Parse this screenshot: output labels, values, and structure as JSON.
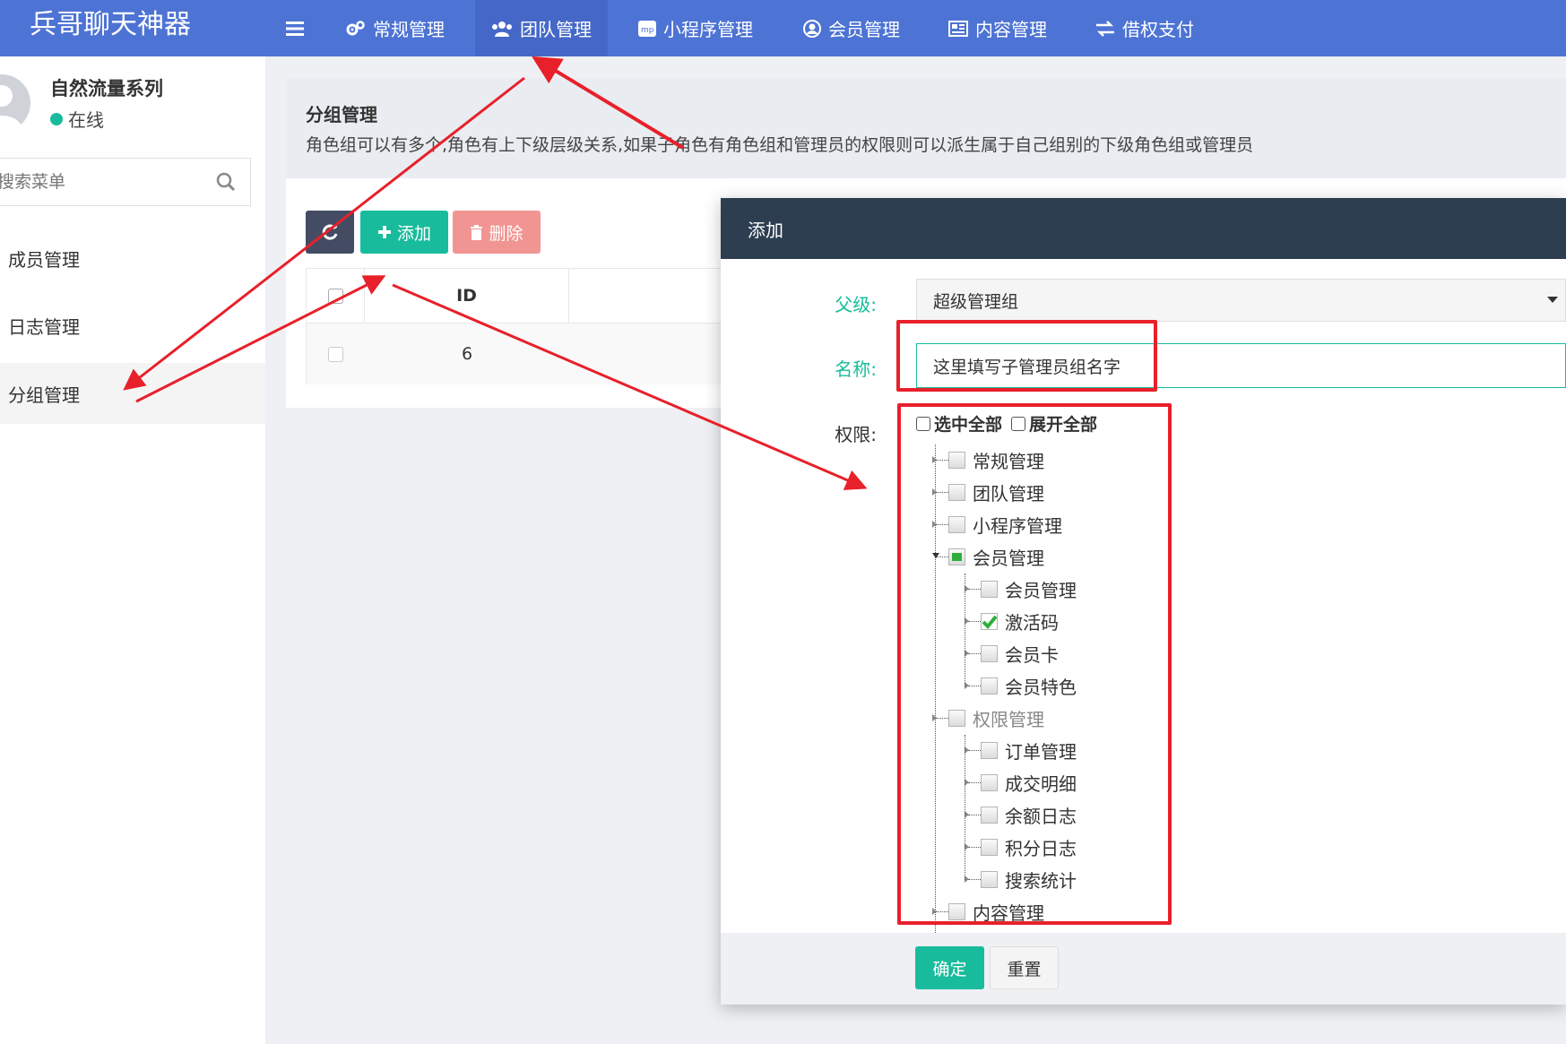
{
  "app": {
    "title": "兵哥聊天神器"
  },
  "topnav": {
    "items": [
      {
        "label": "常规管理",
        "icon": "gears-icon"
      },
      {
        "label": "团队管理",
        "icon": "users-icon"
      },
      {
        "label": "小程序管理",
        "icon": "mp-icon"
      },
      {
        "label": "会员管理",
        "icon": "user-circle-icon"
      },
      {
        "label": "内容管理",
        "icon": "newspaper-icon"
      },
      {
        "label": "借权支付",
        "icon": "exchange-icon"
      }
    ],
    "active": "团队管理"
  },
  "sidebar": {
    "user": {
      "name": "自然流量系列",
      "status": "在线",
      "status_color": "#18bc9c"
    },
    "search": {
      "placeholder": "搜索菜单"
    },
    "items": [
      {
        "label": "成员管理"
      },
      {
        "label": "日志管理"
      },
      {
        "label": "分组管理"
      }
    ],
    "active": "分组管理"
  },
  "page": {
    "title": "分组管理",
    "description": "角色组可以有多个,角色有上下级层级关系,如果子角色有角色组和管理员的权限则可以派生属于自己组别的下级角色组或管理员"
  },
  "toolbar": {
    "add_label": "添加",
    "delete_label": "删除"
  },
  "table": {
    "columns": [
      "ID"
    ],
    "rows": [
      {
        "id": "6"
      }
    ]
  },
  "modal": {
    "title": "添加",
    "parent": {
      "label": "父级:",
      "value": "超级管理组"
    },
    "name": {
      "label": "名称:",
      "value": "这里填写子管理员组名字"
    },
    "permissions": {
      "label": "权限:",
      "select_all": "选中全部",
      "expand_all": "展开全部",
      "tree": [
        {
          "label": "常规管理",
          "level": 0,
          "state": "unchecked"
        },
        {
          "label": "团队管理",
          "level": 0,
          "state": "unchecked"
        },
        {
          "label": "小程序管理",
          "level": 0,
          "state": "unchecked"
        },
        {
          "label": "会员管理",
          "level": 0,
          "state": "partial"
        },
        {
          "label": "会员管理",
          "level": 1,
          "state": "unchecked"
        },
        {
          "label": "激活码",
          "level": 1,
          "state": "checked"
        },
        {
          "label": "会员卡",
          "level": 1,
          "state": "unchecked"
        },
        {
          "label": "会员特色",
          "level": 1,
          "state": "unchecked"
        },
        {
          "label": "权限管理",
          "level": 0,
          "state": "disabled"
        },
        {
          "label": "订单管理",
          "level": 1,
          "state": "unchecked"
        },
        {
          "label": "成交明细",
          "level": 1,
          "state": "unchecked"
        },
        {
          "label": "余额日志",
          "level": 1,
          "state": "unchecked"
        },
        {
          "label": "积分日志",
          "level": 1,
          "state": "unchecked"
        },
        {
          "label": "搜索统计",
          "level": 1,
          "state": "unchecked"
        },
        {
          "label": "内容管理",
          "level": 0,
          "state": "unchecked"
        }
      ]
    },
    "ok_label": "确定",
    "reset_label": "重置"
  },
  "colors": {
    "topbar": "#4d73d4",
    "accent": "#18bc9c",
    "danger": "#f19592",
    "modal_header": "#2c3e50",
    "annotation": "#e8202a"
  }
}
